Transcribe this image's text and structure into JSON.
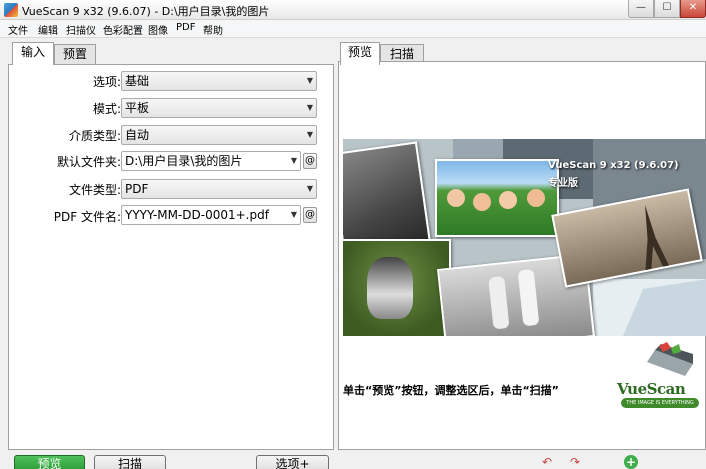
{
  "window": {
    "title": "VueScan 9 x32 (9.6.07) - D:\\用户目录\\我的图片"
  },
  "title_buttons": {
    "minimize": "—",
    "maximize": "☐",
    "close": "✕"
  },
  "menu": [
    "文件",
    "编辑",
    "扫描仪",
    "色彩配置",
    "图像",
    "PDF",
    "帮助"
  ],
  "left_tabs": [
    "输入",
    "预置"
  ],
  "form": {
    "options": {
      "label": "选项:",
      "value": "基础"
    },
    "mode": {
      "label": "模式:",
      "value": "平板"
    },
    "media": {
      "label": "介质类型:",
      "value": "自动"
    },
    "default_folder": {
      "label": "默认文件夹:",
      "value": "D:\\用户目录\\我的图片"
    },
    "file_type": {
      "label": "文件类型:",
      "value": "PDF"
    },
    "pdf_name": {
      "label": "PDF 文件名:",
      "value": "YYYY-MM-DD-0001+.pdf"
    },
    "at_symbol": "@"
  },
  "right_tabs": [
    "预览",
    "扫描"
  ],
  "splash": {
    "product_title": "VueScan 9 x32 (9.6.07)",
    "edition": "专业版",
    "instruction": "单击“预览”按钮，调整选区后，单击“扫描”",
    "logo_name": "VueScan",
    "logo_tagline": "THE IMAGE IS EVERYTHING"
  },
  "buttons": {
    "preview": "预览",
    "scan": "扫描",
    "options": "选项+"
  },
  "icons": [
    "rotate-left-icon",
    "rotate-right-icon",
    "zoom-in-icon"
  ],
  "colors": {
    "primary_button": "#2a9a35",
    "logo_green": "#3f8b2b"
  }
}
